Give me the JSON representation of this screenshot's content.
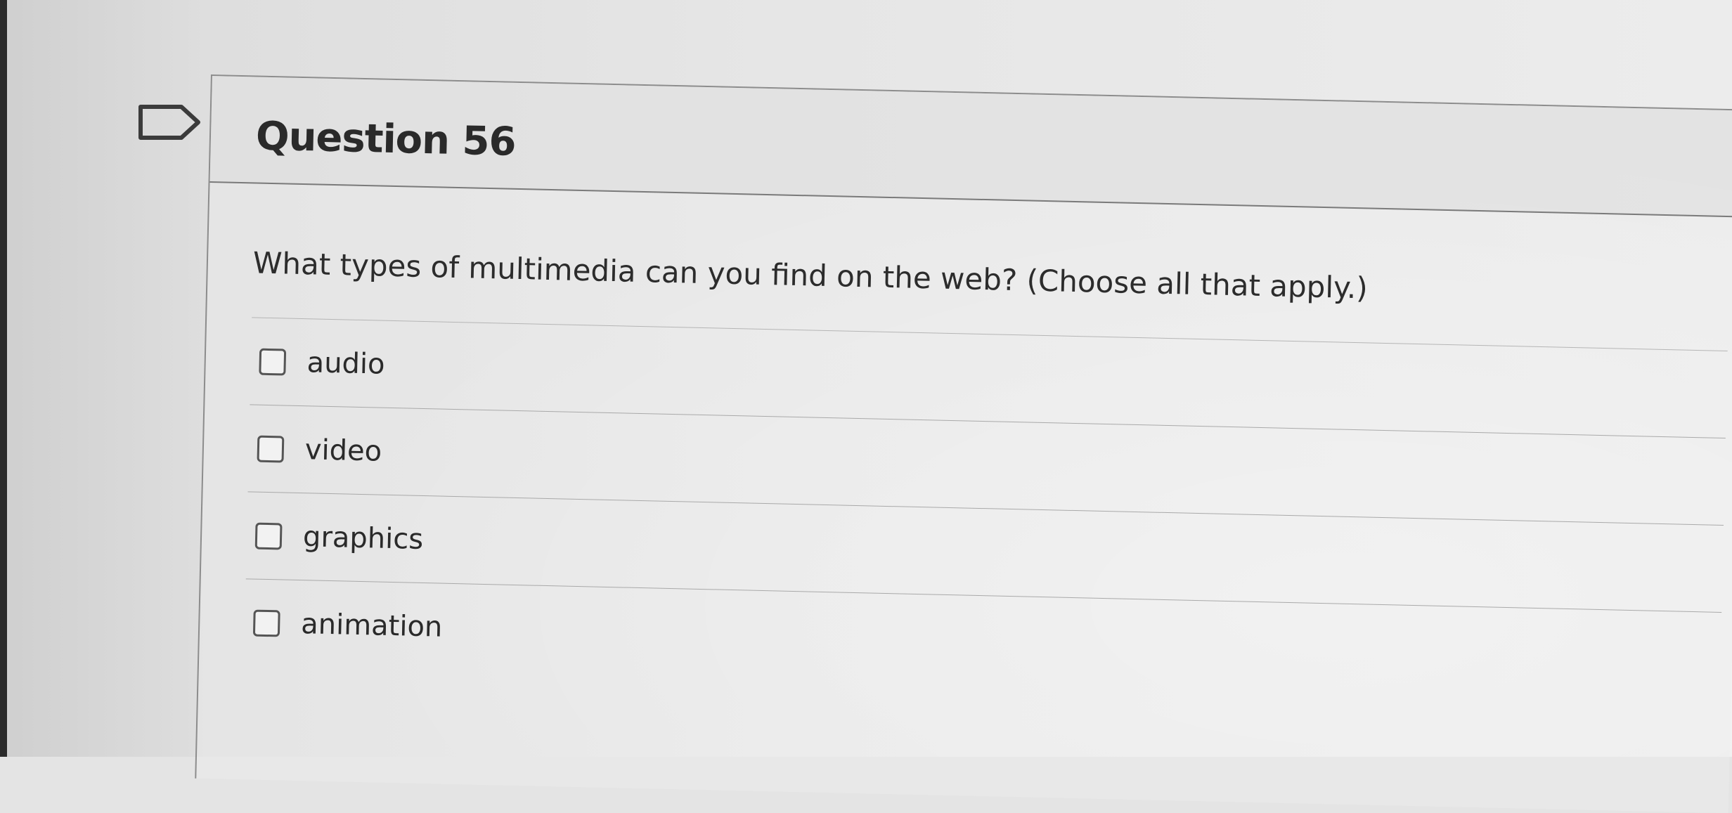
{
  "question": {
    "title": "Question 56",
    "text": "What types of multimedia can you find on the web? (Choose all that apply.)",
    "answers": [
      {
        "label": "audio",
        "checked": false
      },
      {
        "label": "video",
        "checked": false
      },
      {
        "label": "graphics",
        "checked": false
      },
      {
        "label": "animation",
        "checked": false
      }
    ]
  },
  "icons": {
    "flag": "flag-question-icon"
  }
}
